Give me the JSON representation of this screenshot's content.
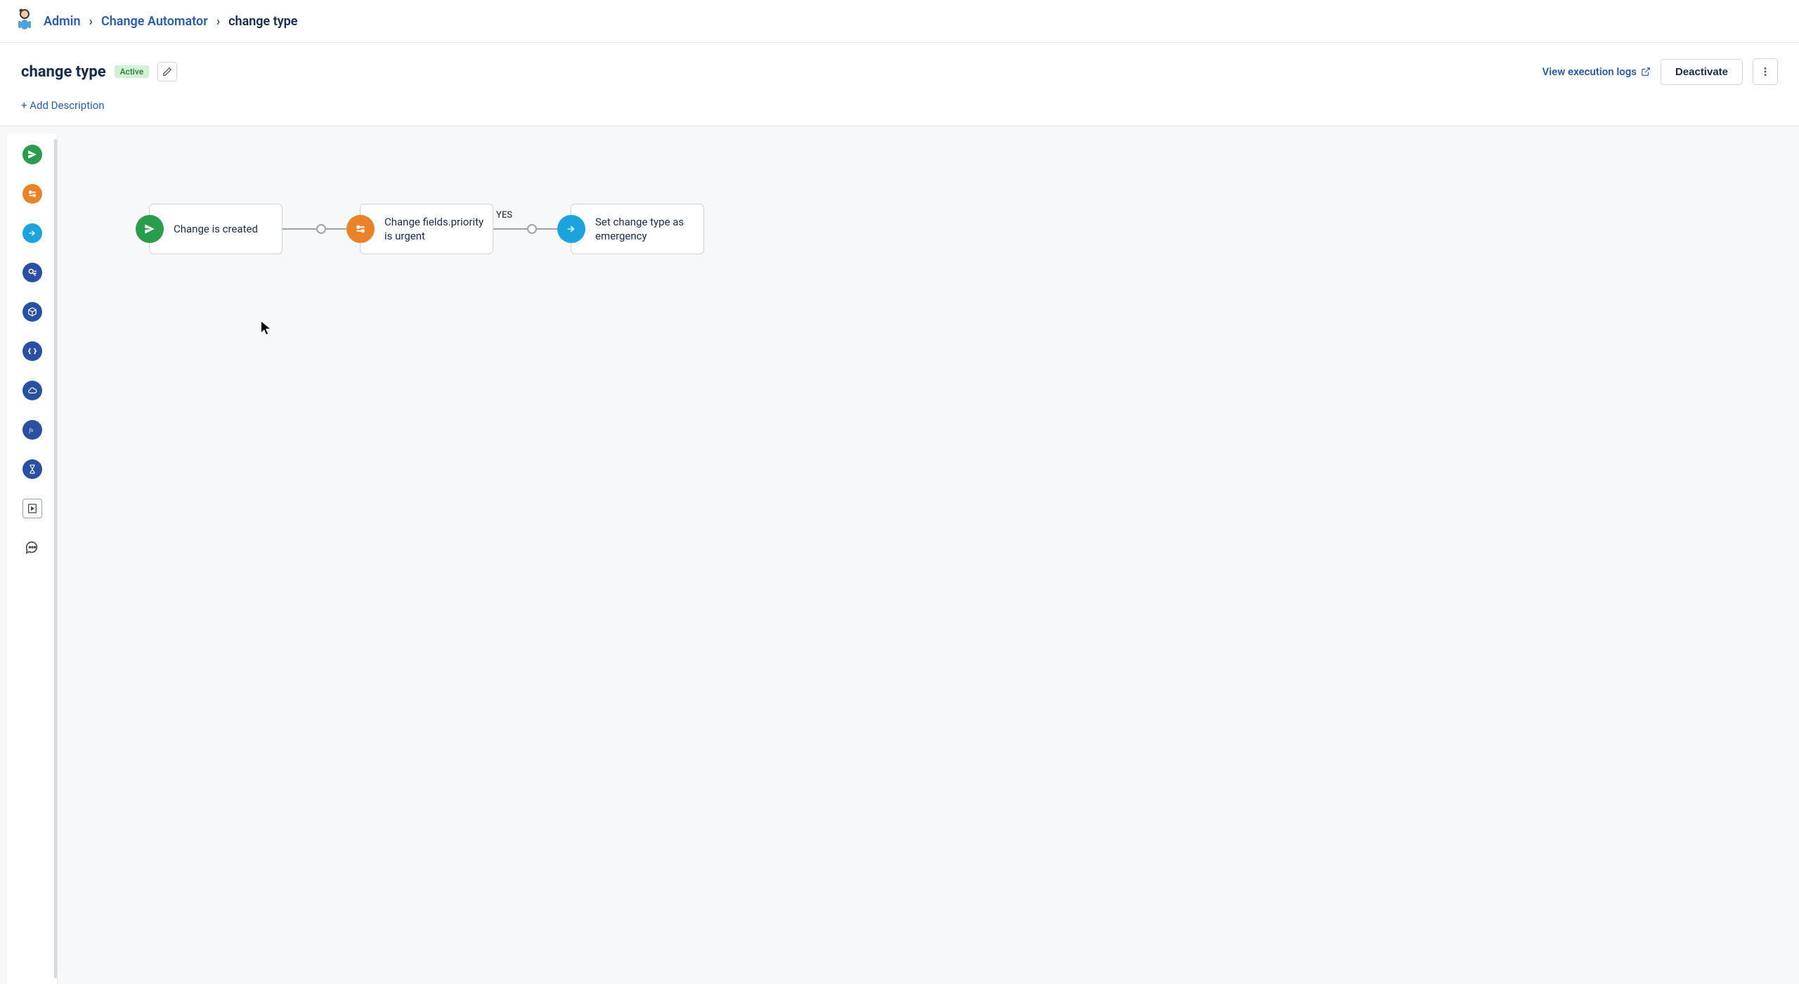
{
  "breadcrumb": {
    "admin": "Admin",
    "automator": "Change Automator",
    "current": "change type"
  },
  "header": {
    "title": "change type",
    "status": "Active",
    "view_logs": "View execution logs",
    "deactivate": "Deactivate",
    "add_description": "+ Add Description"
  },
  "siderail": {
    "items": [
      {
        "name": "event-trigger-icon",
        "color": "green"
      },
      {
        "name": "condition-icon",
        "color": "orange"
      },
      {
        "name": "action-icon",
        "color": "cyan"
      },
      {
        "name": "reader-icon",
        "color": "navy"
      },
      {
        "name": "cube-icon",
        "color": "navy"
      },
      {
        "name": "code-icon",
        "color": "navy"
      },
      {
        "name": "cloud-icon",
        "color": "navy"
      },
      {
        "name": "function-icon",
        "color": "navy"
      },
      {
        "name": "timer-icon",
        "color": "navy"
      }
    ]
  },
  "flow": {
    "nodes": [
      {
        "label": "Change is created",
        "icon_color": "green",
        "icon_name": "event-trigger-icon"
      },
      {
        "label": "Change fields.priority is urgent",
        "icon_color": "orange",
        "icon_name": "condition-icon"
      },
      {
        "label": "Set change type as emergency",
        "icon_color": "cyan",
        "icon_name": "action-icon"
      }
    ],
    "connectors": [
      {
        "label": ""
      },
      {
        "label": "YES"
      }
    ]
  }
}
